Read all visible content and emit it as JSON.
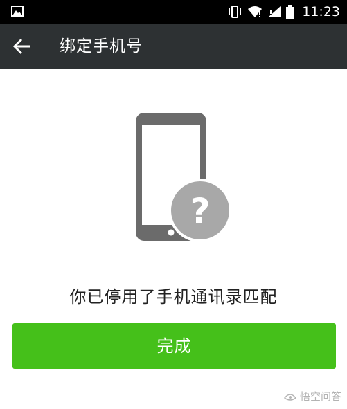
{
  "status_bar": {
    "time": "11:23",
    "icons": [
      "image-icon",
      "vibrate-icon",
      "wifi-icon",
      "signal-icon",
      "battery-icon"
    ]
  },
  "app_bar": {
    "back_icon": "back-arrow-icon",
    "title": "绑定手机号"
  },
  "main": {
    "illustration_icon": "phone-question-icon",
    "question_mark": "?",
    "message": "你已停用了手机通讯录匹配",
    "done_label": "完成"
  },
  "watermark": {
    "text": "悟空问答"
  },
  "colors": {
    "status_bar_bg": "#000000",
    "app_bar_bg": "#2d3133",
    "primary_button": "#45c01a",
    "illustration_gray": "#6b6b6b"
  }
}
